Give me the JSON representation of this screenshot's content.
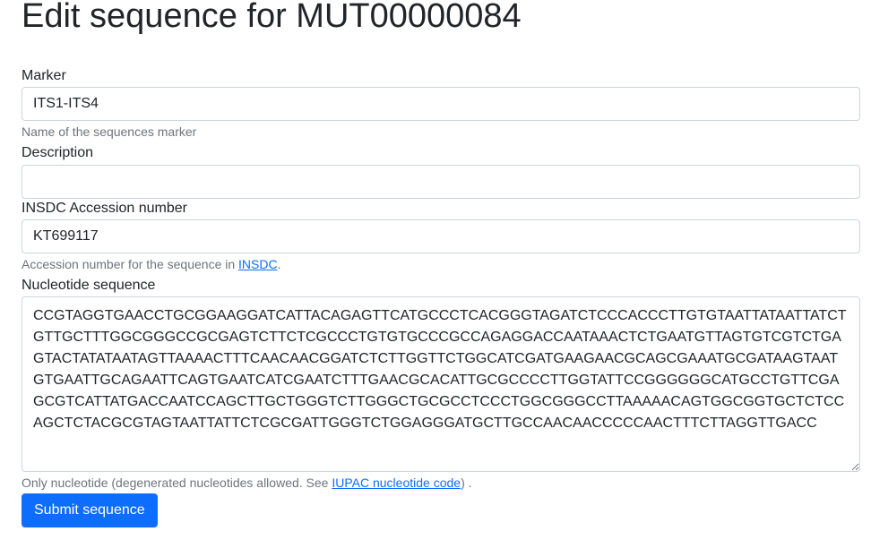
{
  "page_title": "Edit sequence for MUT00000084",
  "form": {
    "marker": {
      "label": "Marker",
      "value": "ITS1-ITS4",
      "help": "Name of the sequences marker"
    },
    "description": {
      "label": "Description",
      "value": ""
    },
    "accession": {
      "label": "INSDC Accession number",
      "value": "KT699117",
      "help_prefix": "Accession number for the sequence in ",
      "help_link": "INSDC",
      "help_suffix": "."
    },
    "sequence": {
      "label": "Nucleotide sequence",
      "value": "CCGTAGGTGAACCTGCGGAAGGATCATTACAGAGTTCATGCCCTCACGGGTAGATCTCCCACCCTTGTGTAATTATAATTATCTGTTGCTTTGGCGGGCCGCGAGTCTTCTCGCCCTGTGTGCCCGCCAGAGGACCAATAAACTCTGAATGTTAGTGTCGTCTGAGTACTATATAATAGTTAAAACTTTCAACAACGGATCTCTTGGTTCTGGCATCGATGAAGAACGCAGCGAAATGCGATAAGTAATGTGAATTGCAGAATTCAGTGAATCATCGAATCTTTGAACGCACATTGCGCCCCTTGGTATTCCGGGGGGCATGCCTGTTCGAGCGTCATTATGACCAATCCAGCTTGCTGGGTCTTGGGCTGCGCCTCCCTGGCGGGCCTTAAAAACAGTGGCGGTGCTCTCCAGCTCTACGCGTAGTAATTATTCTCGCGATTGGGTCTGGAGGGATGCTTGCCAACAACCCCCAACTTTCTTAGGTTGACC",
      "help_prefix": "Only nucleotide (degenerated nucleotides allowed. See ",
      "help_link": "IUPAC nucleotide code",
      "help_suffix": ") ."
    },
    "submit_label": "Submit sequence"
  },
  "colors": {
    "primary": "#0d6efd",
    "text": "#212529",
    "muted": "#6c757d",
    "border": "#ced4da"
  }
}
